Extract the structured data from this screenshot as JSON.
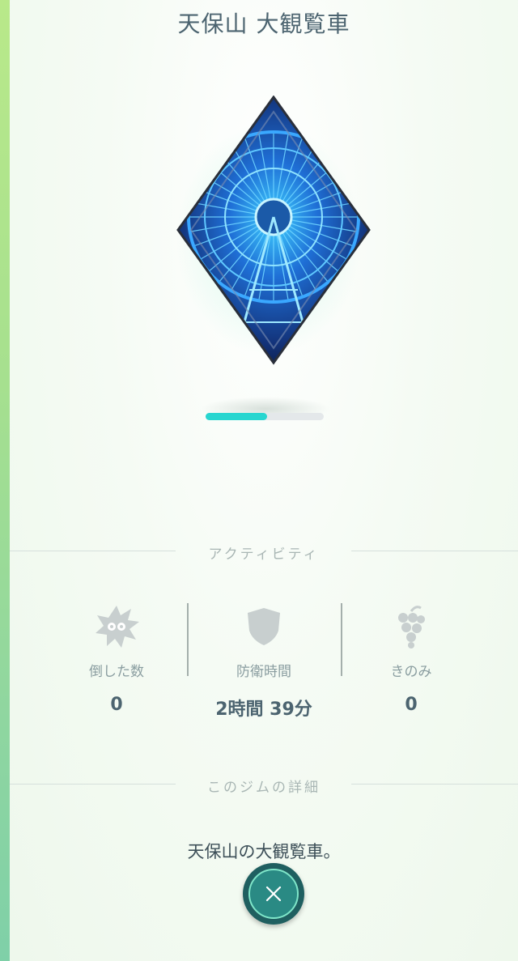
{
  "gym": {
    "name": "天保山 大観覧車",
    "description": "天保山の大観覧車。",
    "prestige_progress": 0.52
  },
  "sections": {
    "activity": "アクティビティ",
    "details": "このジムの詳細"
  },
  "stats": [
    {
      "icon": "defeated-icon",
      "label": "倒した数",
      "value": "0"
    },
    {
      "icon": "shield-icon",
      "label": "防衛時間",
      "value": "2時間 39分"
    },
    {
      "icon": "berry-icon",
      "label": "きのみ",
      "value": "0"
    }
  ],
  "colors": {
    "accent_teal": "#28d6d0",
    "text_dark": "#4c6470",
    "close_button": "#2a8a84"
  },
  "close_button": {
    "icon": "close-icon"
  }
}
